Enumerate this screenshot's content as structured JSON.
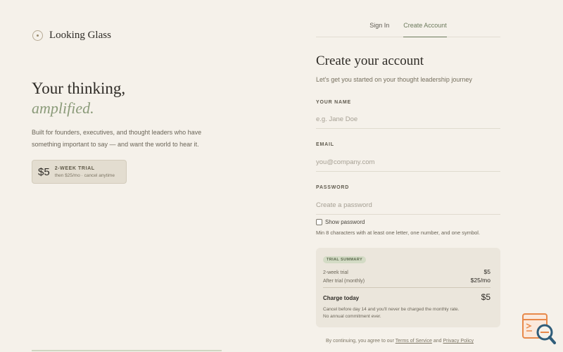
{
  "brand": {
    "name": "Looking Glass"
  },
  "hero": {
    "line1": "Your thinking,",
    "line2": "amplified.",
    "description": "Built for founders, executives, and thought leaders who have something important to say — and want the world to hear it."
  },
  "trial_badge": {
    "price": "$5",
    "title": "2-WEEK TRIAL",
    "subtitle": "then $25/mo · cancel anytime"
  },
  "tabs": [
    {
      "label": "Sign In",
      "active": false
    },
    {
      "label": "Create Account",
      "active": true
    }
  ],
  "form": {
    "title": "Create your account",
    "subtitle": "Let's get you started on your thought leadership journey",
    "name": {
      "label": "YOUR NAME",
      "placeholder": "e.g. Jane Doe",
      "value": ""
    },
    "email": {
      "label": "EMAIL",
      "placeholder": "you@company.com",
      "value": ""
    },
    "password": {
      "label": "PASSWORD",
      "placeholder": "Create a password",
      "value": ""
    },
    "show_password_label": "Show password",
    "show_password_checked": false,
    "password_hint": "Min 8 characters with at least one letter, one number, and one symbol."
  },
  "summary": {
    "tag": "TRIAL SUMMARY",
    "rows": [
      {
        "label": "2-week trial",
        "value": "$5"
      },
      {
        "label": "After trial (monthly)",
        "value": "$25/mo"
      }
    ],
    "charge_label": "Charge today",
    "charge_value": "$5",
    "note1": "Cancel before day 14 and you'll never be charged the monthly rate.",
    "note2": "No annual commitment ever."
  },
  "legal": {
    "prefix": "By continuing, you agree to our",
    "terms": "Terms of Service",
    "and": "and",
    "privacy": "Privacy Policy"
  },
  "colors": {
    "background": "#f5f1ea",
    "accent": "#6c7a5c",
    "fab_primary": "#e8894a",
    "fab_secondary": "#2f5d7a"
  },
  "icons": {
    "brand": "circle-dot-icon",
    "fab": "search-chart-icon"
  }
}
